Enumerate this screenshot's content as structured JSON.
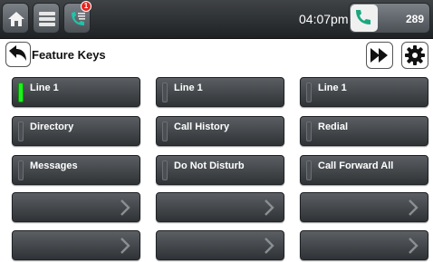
{
  "topbar": {
    "icons": [
      "home-icon",
      "menu-icon",
      "call-log-icon",
      "phone-icon",
      "back-arrow-icon",
      "fast-forward-icon",
      "gear-icon"
    ],
    "badge_count": "1",
    "time": "04:07pm",
    "extension": "289"
  },
  "header": {
    "title": "Feature Keys"
  },
  "colors": {
    "active_indicator": "#1df01d",
    "badge": "#e8221c",
    "key_background": "#3a3e41"
  },
  "keys": [
    {
      "label": "Line 1",
      "active": true
    },
    {
      "label": "Line 1",
      "active": false
    },
    {
      "label": "Line 1",
      "active": false
    },
    {
      "label": "Directory",
      "active": false
    },
    {
      "label": "Call History",
      "active": false
    },
    {
      "label": "Redial",
      "active": false
    },
    {
      "label": "Messages",
      "active": false
    },
    {
      "label": "Do Not Disturb",
      "active": false
    },
    {
      "label": "Call Forward All",
      "active": false
    },
    {
      "label": "",
      "empty": true
    },
    {
      "label": "",
      "empty": true
    },
    {
      "label": "",
      "empty": true
    },
    {
      "label": "",
      "empty": true
    },
    {
      "label": "",
      "empty": true
    },
    {
      "label": "",
      "empty": true
    }
  ]
}
